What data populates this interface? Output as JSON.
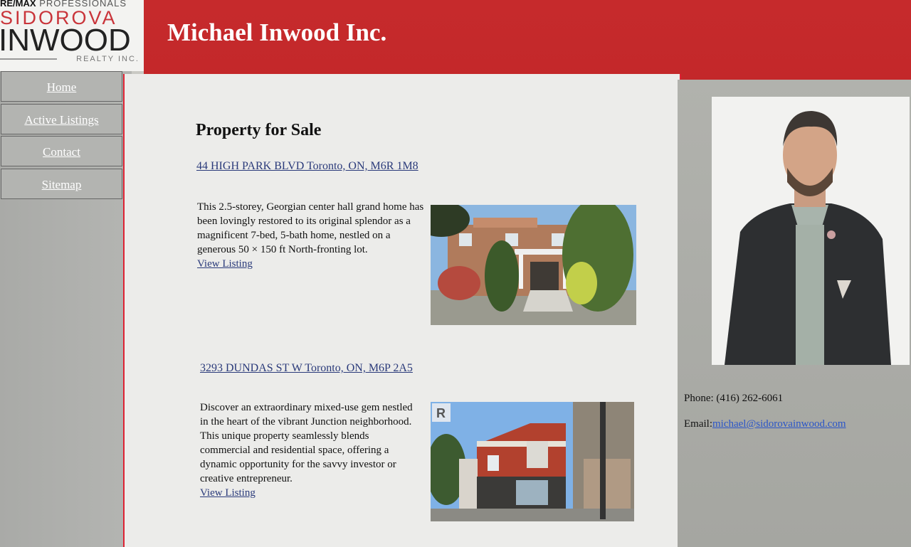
{
  "logo": {
    "line1_brand": "RE/MAX",
    "line1_rest": "PROFESSIONALS",
    "line2": "SIDOROVA",
    "line3": "INWOOD",
    "line4": "REALTY INC."
  },
  "header": {
    "title": "Michael Inwood Inc."
  },
  "nav": {
    "items": [
      {
        "label": "Home"
      },
      {
        "label": "Active Listings"
      },
      {
        "label": "Contact"
      },
      {
        "label": "Sitemap"
      }
    ]
  },
  "main": {
    "heading": "Property for Sale",
    "listings": [
      {
        "address": "44 HIGH PARK BLVD Toronto, ON, M6R 1M8",
        "description": "This 2.5-storey, Georgian center hall grand home has been lovingly restored to its original splendor as a magnificent 7-bed, 5-bath home, nestled on a generous 50 × 150 ft North-fronting lot.",
        "link_label": "View Listing"
      },
      {
        "address": "3293 DUNDAS ST W Toronto, ON, M6P 2A5",
        "description": "Discover an extraordinary mixed-use gem nestled in the heart of the vibrant Junction neighborhood. This unique property seamlessly blends commercial and residential space, offering a dynamic opportunity for the savvy investor or creative entrepreneur.",
        "link_label": "View Listing"
      }
    ]
  },
  "agent": {
    "phone_label": "Phone: (416) 262-6061",
    "email_label": "Email:",
    "email": "michael@sidorovainwood.com"
  },
  "colors": {
    "header_red": "#c62a2c",
    "link_blue": "#2a3a7a",
    "email_blue": "#2a55c8"
  }
}
